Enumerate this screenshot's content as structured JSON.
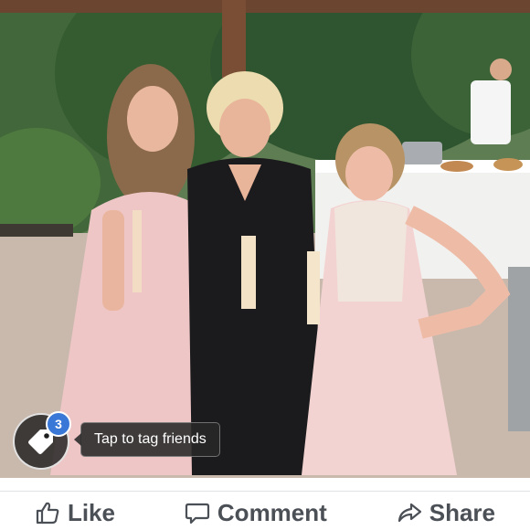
{
  "photo": {
    "alt_subject": "photo"
  },
  "tag": {
    "badge_count": "3",
    "tooltip": "Tap to tag friends",
    "icon": "tag-icon"
  },
  "actions": {
    "like_label": "Like",
    "comment_label": "Comment",
    "share_label": "Share",
    "like_icon": "thumbs-up-icon",
    "comment_icon": "comment-icon",
    "share_icon": "share-arrow-icon"
  },
  "colors": {
    "action_text": "#4b4f56",
    "badge": "#3a78d8",
    "divider": "#dfe2e6"
  }
}
